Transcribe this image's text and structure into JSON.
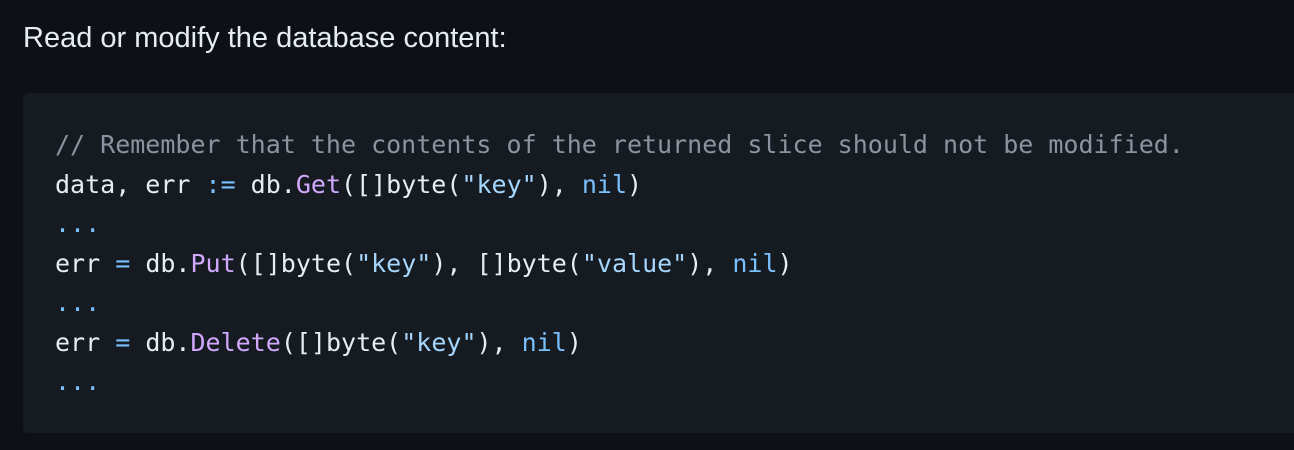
{
  "intro_text": "Read or modify the database content:",
  "code": {
    "comment": "// Remember that the contents of the returned slice should not be modified.",
    "line_get": {
      "lhs": "data, err ",
      "op": ":=",
      "recv": " db.",
      "fn": "Get",
      "args_open": "([]byte(",
      "key": "\"key\"",
      "args_mid": "), ",
      "nil": "nil",
      "close": ")"
    },
    "ellipsis": "...",
    "line_put": {
      "lhs": "err ",
      "op": "=",
      "recv": " db.",
      "fn": "Put",
      "args_open": "([]byte(",
      "key": "\"key\"",
      "args_mid": "), []byte(",
      "value": "\"value\"",
      "args_mid2": "), ",
      "nil": "nil",
      "close": ")"
    },
    "line_delete": {
      "lhs": "err ",
      "op": "=",
      "recv": " db.",
      "fn": "Delete",
      "args_open": "([]byte(",
      "key": "\"key\"",
      "args_mid": "), ",
      "nil": "nil",
      "close": ")"
    }
  },
  "colors": {
    "page_background": "#0d1117",
    "code_background": "#161b22",
    "text": "#e6edf3",
    "comment": "#8b949e",
    "keyword_constant": "#79c0ff",
    "function": "#d2a8ff",
    "string": "#a5d6ff"
  }
}
